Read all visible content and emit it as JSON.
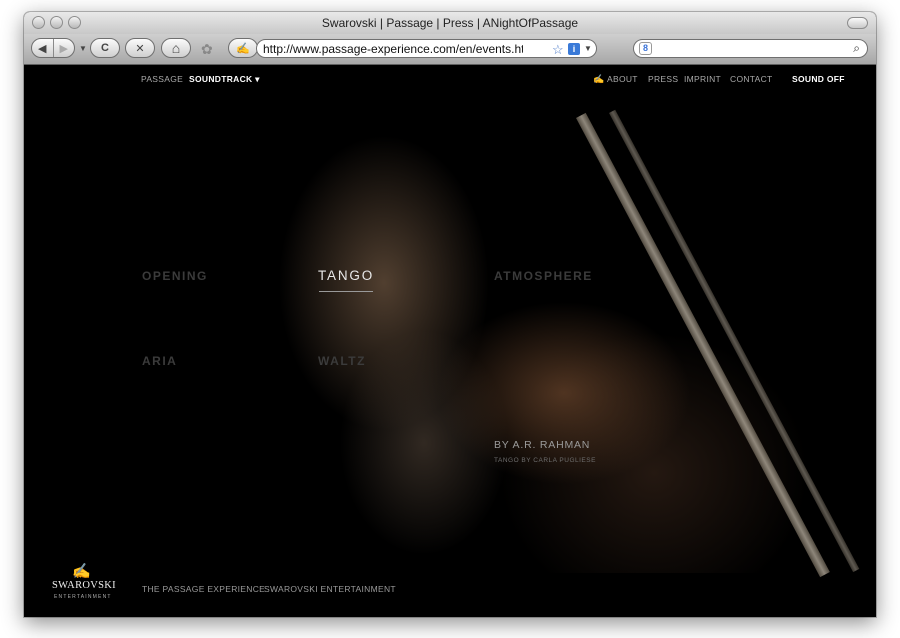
{
  "window": {
    "title": "Swarovski | Passage | Press | ANightOfPassage"
  },
  "toolbar": {
    "url": "http://www.passage-experience.com/en/events.html#/Pr",
    "back_icon": "◀",
    "forward_icon": "▶",
    "dropdown_icon": "▼",
    "reload_icon": "C",
    "stop_icon": "✕",
    "home_icon": "⌂",
    "settings_icon": "✿",
    "page_icon": "✍",
    "bookmark_icon": "☆",
    "info_icon": "i",
    "search_engine_icon": "8",
    "search_placeholder": "",
    "search_icon": "⌕"
  },
  "nav": {
    "passage": "PASSAGE",
    "soundtrack": "SOUNDTRACK ▾",
    "swan_icon": "✍",
    "about": "ABOUT",
    "press": "PRESS",
    "imprint": "IMPRINT",
    "contact": "CONTACT",
    "sound": "SOUND OFF"
  },
  "tracks": {
    "opening": "OPENING",
    "tango": "TANGO",
    "atmosphere": "ATMOSPHERE",
    "aria": "ARIA",
    "waltz": "WALTZ"
  },
  "details": {
    "artist": "BY A.R. RAHMAN",
    "credit": "TANGO BY CARLA PUGLIESE"
  },
  "footer": {
    "swan": "✍",
    "brand": "SWAROVSKI",
    "brand_sub": "ENTERTAINMENT",
    "link1": "THE PASSAGE EXPERIENCE",
    "link2": "SWAROVSKI ENTERTAINMENT"
  }
}
